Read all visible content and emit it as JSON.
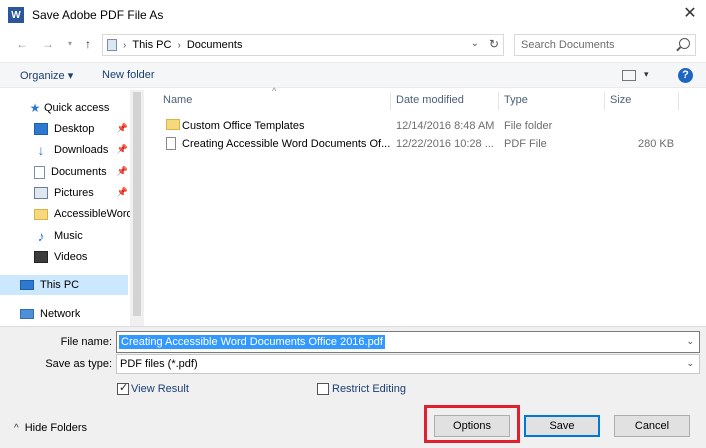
{
  "window": {
    "title": "Save Adobe PDF File As",
    "app_icon_letter": "W"
  },
  "address": {
    "crumbs": [
      "This PC",
      "Documents"
    ],
    "search_placeholder": "Search Documents"
  },
  "commands": {
    "organize": "Organize ▾",
    "new_folder": "New folder"
  },
  "sidebar": {
    "quick_access": "Quick access",
    "items": [
      "Desktop",
      "Downloads",
      "Documents",
      "Pictures",
      "AccessibleWord",
      "Music",
      "Videos"
    ],
    "this_pc": "This PC",
    "network": "Network"
  },
  "columns": {
    "name": "Name",
    "date": "Date modified",
    "type": "Type",
    "size": "Size"
  },
  "files": [
    {
      "name": "Custom Office Templates",
      "date": "12/14/2016 8:48 AM",
      "type": "File folder",
      "size": ""
    },
    {
      "name": "Creating Accessible Word Documents Of...",
      "date": "12/22/2016 10:28 ...",
      "type": "PDF File",
      "size": "280 KB"
    }
  ],
  "form": {
    "file_name_label": "File name:",
    "file_name_value": "Creating Accessible Word Documents Office 2016.pdf",
    "save_type_label": "Save as type:",
    "save_type_value": "PDF files (*.pdf)",
    "view_result": "View Result",
    "restrict_editing": "Restrict Editing",
    "hide_folders": "Hide Folders"
  },
  "buttons": {
    "options": "Options",
    "save": "Save",
    "cancel": "Cancel"
  },
  "colors": {
    "highlight": "#e0202f",
    "selection": "#3399ff",
    "accent": "#0078d7"
  }
}
